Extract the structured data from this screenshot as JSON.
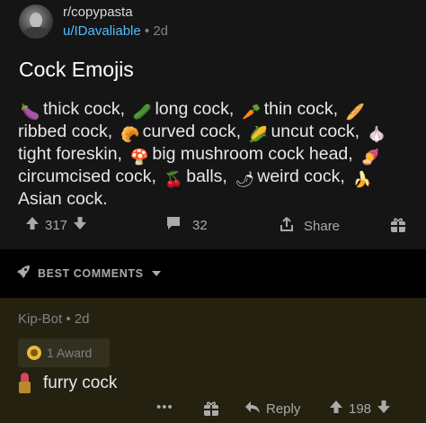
{
  "post": {
    "subreddit": "r/copypasta",
    "author": "u/IDavaliable",
    "separator": "•",
    "age": "2d",
    "title": "Cock Emojis",
    "body": [
      {
        "emoji": "🍆",
        "icon": "eggplant-icon",
        "text": "thick cock,"
      },
      {
        "emoji": "🥒",
        "icon": "cucumber-icon",
        "text": "long cock,"
      },
      {
        "emoji": "🥕",
        "icon": "carrot-icon",
        "text": "thin cock,"
      },
      {
        "emoji": "🥖",
        "icon": "baguette-icon",
        "text": "ribbed cock,"
      },
      {
        "emoji": "🥐",
        "icon": "croissant-icon",
        "text": "curved cock,"
      },
      {
        "emoji": "🌽",
        "icon": "corn-icon",
        "text": "uncut cock,"
      },
      {
        "emoji": "🧄",
        "icon": "garlic-icon",
        "text": "tight foreskin,"
      },
      {
        "emoji": "🍄",
        "icon": "mushroom-icon",
        "text": "big mushroom cock head,"
      },
      {
        "emoji": "🍠",
        "icon": "sweet-potato-icon",
        "text": "circumcised cock,"
      },
      {
        "emoji": "🍒",
        "icon": "cherries-icon",
        "text": "balls,"
      },
      {
        "emoji": "🌶",
        "icon": "chili-pepper-icon",
        "text": "weird cock,"
      },
      {
        "emoji": "🍌",
        "icon": "banana-icon",
        "text": "Asian cock."
      }
    ],
    "upvotes": "317",
    "comments": "32",
    "share_label": "Share"
  },
  "sort": {
    "label": "BEST COMMENTS"
  },
  "comment": {
    "author": "Kip-Bot",
    "separator": "•",
    "age": "2d",
    "award_label": "1 Award",
    "text": "furry cock",
    "more": "•••",
    "reply_label": "Reply",
    "upvotes": "198"
  },
  "colors": {
    "background": "#000000",
    "post_bg": "#151515",
    "comment_bg": "#242111",
    "username": "#4fbcff",
    "muted": "#818384"
  }
}
